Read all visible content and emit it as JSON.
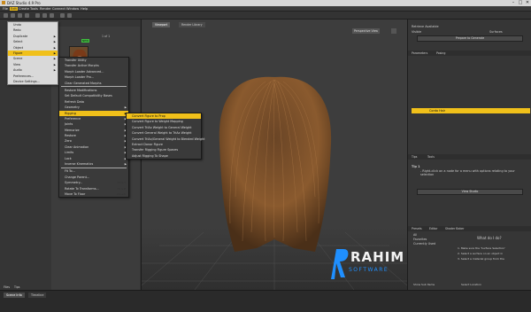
{
  "titlebar": {
    "title": "DAZ Studio 4.9 Pro",
    "min": "–",
    "max": "□",
    "close": "✕"
  },
  "menubar": [
    "File",
    "Edit",
    "Create",
    "Tools",
    "Render",
    "Connect",
    "Window",
    "Help"
  ],
  "file_menu": {
    "items": [
      {
        "label": "Undo",
        "arrow": false
      },
      {
        "label": "Redo",
        "arrow": false
      },
      {
        "label": "Duplicate",
        "arrow": true
      },
      {
        "label": "Select",
        "arrow": true
      },
      {
        "label": "Object",
        "arrow": true
      },
      {
        "label": "Figure",
        "arrow": true,
        "highlight": true
      },
      {
        "label": "Scene",
        "arrow": true
      },
      {
        "label": "View",
        "arrow": true
      },
      {
        "label": "Audio",
        "arrow": true
      },
      {
        "label": "Preferences...",
        "arrow": false
      },
      {
        "label": "Device Settings...",
        "arrow": false
      }
    ]
  },
  "figure_menu": {
    "items": [
      {
        "label": "Transfer Utility"
      },
      {
        "label": "Transfer Active Morphs"
      },
      {
        "label": "Morph Loader Advanced..."
      },
      {
        "label": "Morph Loader Pro..."
      },
      {
        "label": "Clear Generated Morphs"
      },
      {
        "label": "Restore Modifications"
      },
      {
        "label": "Set Default Compatibility Bases"
      },
      {
        "label": "Refresh Data"
      },
      {
        "label": "Geometry",
        "arrow": true
      },
      {
        "label": "Rigging",
        "arrow": true,
        "highlight": true
      },
      {
        "label": "Preference",
        "arrow": true
      },
      {
        "label": "Joints",
        "arrow": true
      },
      {
        "label": "Memorize",
        "arrow": true
      },
      {
        "label": "Restore",
        "arrow": true
      },
      {
        "label": "Zero",
        "arrow": true
      },
      {
        "label": "Clear Animation",
        "arrow": true
      },
      {
        "label": "Limits",
        "arrow": true
      },
      {
        "label": "Lock",
        "arrow": true
      },
      {
        "label": "Inverse Kinematics",
        "arrow": true
      },
      {
        "label": "Fit To..."
      },
      {
        "label": "Change Parent..."
      },
      {
        "label": "Symmetry...",
        "shortcut": "Ctrl+Y"
      },
      {
        "label": "Rotate To Transforms...",
        "shortcut": "Ctrl+E"
      },
      {
        "label": "Move To Floor",
        "shortcut": "Ctrl+D"
      }
    ]
  },
  "rigging_menu": {
    "items": [
      {
        "label": "Convert Figure to Prop",
        "highlight": true
      },
      {
        "label": "Convert Figure to Weight Mapping"
      },
      {
        "label": "Convert TriAx Weight to General Weight"
      },
      {
        "label": "Convert General Weight to TriAx Weight"
      },
      {
        "label": "Convert TriAx/General Weight to Blended Weight"
      },
      {
        "label": "Extract Donor Figure"
      },
      {
        "label": "Transfer Rigging Figure Spaces"
      },
      {
        "label": "Adjust Rigging To Shape"
      }
    ]
  },
  "left_panel": {
    "page": "1 of 1",
    "thumb_badge": "NEW"
  },
  "viewport": {
    "tabs": [
      {
        "label": "Viewport",
        "selected": true
      },
      {
        "label": "Render Library",
        "selected": false
      }
    ],
    "camera": "Perspective View"
  },
  "right_panel": {
    "top_rows": [
      "Retrieve Available",
      "Visible"
    ],
    "top_checkbox": "Surfaces",
    "prepare_btn": "Prepare to Generate",
    "props_tabs": [
      "Parameters",
      "Posing"
    ],
    "scene_item": "Corda Hair",
    "bottom_tabs": [
      "Tips",
      "Tools"
    ],
    "tip_title": "Tip 1",
    "tip_text": "- Right-click on a node for a menu with options relating to your selection",
    "view_btn": "View Studio",
    "surface_tabs": [
      "Presets",
      "Editor",
      "Shader Baker"
    ],
    "filter_items": [
      "All",
      "Favorites",
      "Currently Used"
    ],
    "help_title": "What do I do?",
    "help_steps": [
      "1. Make sure the 'Surface Selection'",
      "2. Select a surface on an object in",
      "3. Select a material group from the"
    ],
    "show_sub": "Show Sub Items",
    "select_label": "Select Location"
  },
  "statusbar": {
    "tabs": [
      {
        "label": "Scene Info",
        "selected": true
      },
      {
        "label": "Timeline",
        "selected": false
      }
    ],
    "left_tabs": [
      "Files",
      "Tips"
    ]
  },
  "watermark": {
    "big": "RAHIM",
    "small": "SOFTWARE"
  },
  "colors": {
    "accent": "#f0c01a",
    "bg": "#2b2b2b",
    "menu_bg": "#d9d9d9",
    "watermark_blue": "#1f8fff"
  }
}
